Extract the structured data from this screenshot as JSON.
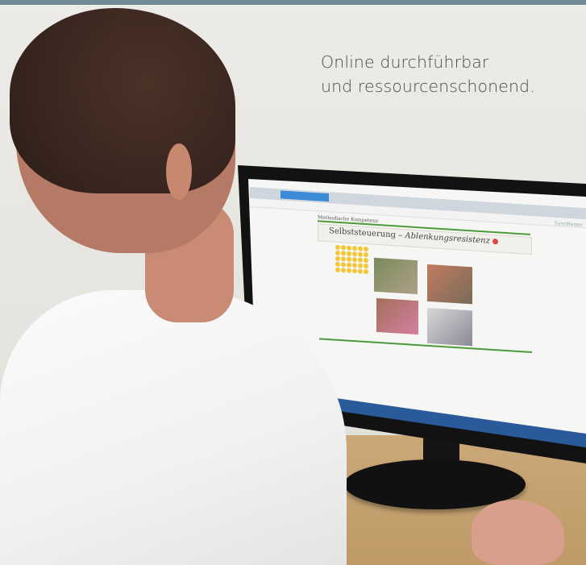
{
  "headline": {
    "line1": "Online durchführbar",
    "line2": "und ressourcenschonend."
  },
  "screen": {
    "site_label": "Methodische Kompetenz",
    "title_prefix": "Selbststeuerung – ",
    "title_italic": "Ablenkungsresistenz",
    "brand": "SyncMaster"
  },
  "colors": {
    "accent_green": "#4c9a3a",
    "top_bar": "#6f8a92",
    "headline_text": "#4a4a4a"
  },
  "icons": {
    "info": "info-icon"
  }
}
